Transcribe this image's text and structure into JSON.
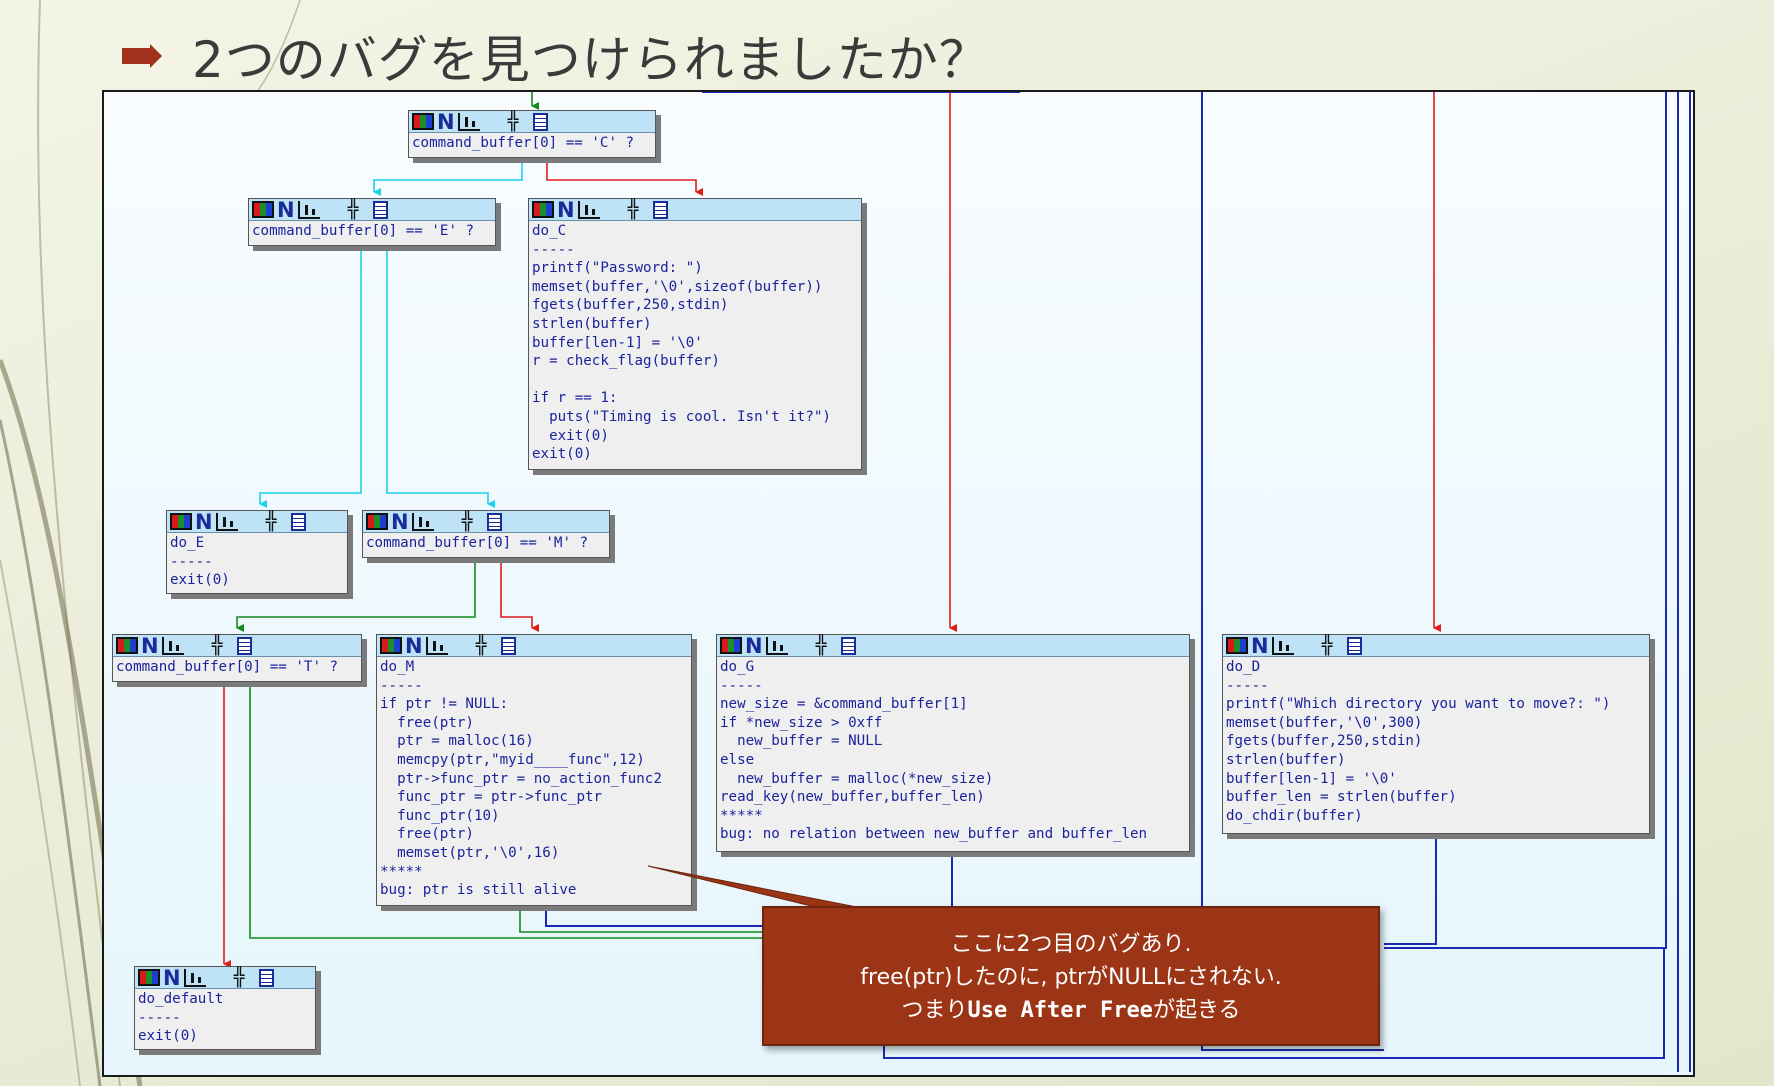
{
  "slide": {
    "title": "2つのバグを見つけられましたか？"
  },
  "colors": {
    "edge_true": "#138a1c",
    "edge_false": "#e01b1b",
    "edge_uncond": "#1ad3e9",
    "edge_blue": "#1a2ab5",
    "header": "#bfe3f6",
    "code_text": "#1a239c",
    "callout_bg": "#9c3515"
  },
  "icons": [
    "graph-overview-icon",
    "node-n-icon",
    "chart-icon",
    "tree-icon",
    "document-icon"
  ],
  "nodes": {
    "cmd_c": {
      "lines": [
        "command_buffer[0] == 'C' ?"
      ]
    },
    "cmd_e": {
      "lines": [
        "command_buffer[0] == 'E' ?"
      ]
    },
    "do_c": {
      "lines": [
        "do_C",
        "-----",
        "printf(\"Password: \")",
        "memset(buffer,'\\0',sizeof(buffer))",
        "fgets(buffer,250,stdin)",
        "strlen(buffer)",
        "buffer[len-1] = '\\0'",
        "r = check_flag(buffer)",
        "",
        "if r == 1:",
        "  puts(\"Timing is cool. Isn't it?\")",
        "  exit(0)",
        "exit(0)"
      ]
    },
    "do_e": {
      "lines": [
        "do_E",
        "-----",
        "exit(0)"
      ]
    },
    "cmd_m": {
      "lines": [
        "command_buffer[0] == 'M' ?"
      ]
    },
    "cmd_t": {
      "lines": [
        "command_buffer[0] == 'T' ?"
      ]
    },
    "do_m": {
      "lines": [
        "do_M",
        "-----",
        "if ptr != NULL:",
        "  free(ptr)",
        "  ptr = malloc(16)",
        "  memcpy(ptr,\"myid____func\",12)",
        "  ptr->func_ptr = no_action_func2",
        "  func_ptr = ptr->func_ptr",
        "  func_ptr(10)",
        "  free(ptr)",
        "  memset(ptr,'\\0',16)",
        "*****",
        "bug: ptr is still alive"
      ]
    },
    "do_g": {
      "lines": [
        "do_G",
        "-----",
        "new_size = &command_buffer[1]",
        "if *new_size > 0xff",
        "  new_buffer = NULL",
        "else",
        "  new_buffer = malloc(*new_size)",
        "read_key(new_buffer,buffer_len)",
        "*****",
        "bug: no relation between new_buffer and buffer_len"
      ]
    },
    "do_d": {
      "lines": [
        "do_D",
        "-----",
        "printf(\"Which directory you want to move?: \")",
        "memset(buffer,'\\0',300)",
        "fgets(buffer,250,stdin)",
        "strlen(buffer)",
        "buffer[len-1] = '\\0'",
        "buffer_len = strlen(buffer)",
        "do_chdir(buffer)"
      ]
    },
    "do_default": {
      "lines": [
        "do_default",
        "-----",
        "exit(0)"
      ]
    }
  },
  "callout": {
    "line1": "ここに2つ目のバグあり.",
    "line2": "free(ptr)したのに, ptrがNULLにされない.",
    "line3_prefix": "つまり",
    "line3_bold": "Use After Free",
    "line3_suffix": "が起きる"
  }
}
